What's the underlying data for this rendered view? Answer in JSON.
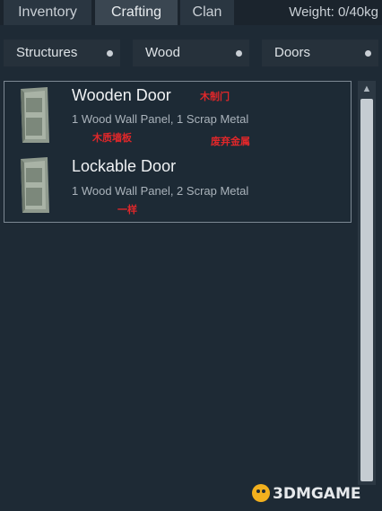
{
  "tabs": [
    {
      "label": "Inventory",
      "active": false
    },
    {
      "label": "Crafting",
      "active": true
    },
    {
      "label": "Clan",
      "active": false
    }
  ],
  "weight": "Weight: 0/40kg",
  "filters": [
    {
      "label": "Structures"
    },
    {
      "label": "Wood"
    },
    {
      "label": "Doors"
    }
  ],
  "items": [
    {
      "name": "Wooden Door",
      "materials": "1 Wood Wall Panel, 1 Scrap Metal",
      "icon": "door-icon",
      "annotations": [
        "木制门",
        "木质墙板",
        "废弃金属"
      ]
    },
    {
      "name": "Lockable Door",
      "materials": "1 Wood Wall Panel, 2 Scrap Metal",
      "icon": "door-icon",
      "annotations": [
        "一样"
      ]
    }
  ],
  "scrollbar": {
    "up_arrow": "▲"
  },
  "watermark": "3DMGAME",
  "colors": {
    "background": "#1e2a35",
    "tab_active": "#3a4651",
    "annotation": "#e0272a"
  }
}
